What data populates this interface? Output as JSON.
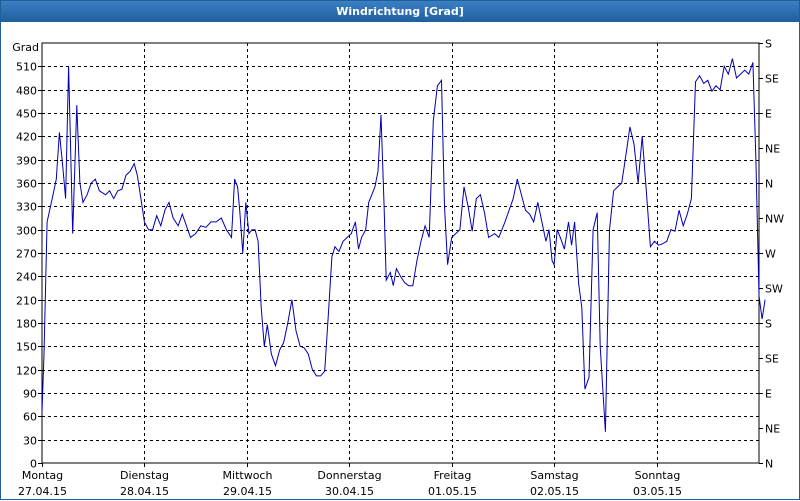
{
  "window": {
    "title": "Windrichtung [Grad]"
  },
  "chart_data": {
    "type": "line",
    "title": "Windrichtung [Grad]",
    "ylabel": "Grad",
    "ylim": [
      0,
      540
    ],
    "yticks": [
      0,
      30,
      60,
      90,
      120,
      150,
      180,
      210,
      240,
      270,
      300,
      330,
      360,
      390,
      420,
      450,
      480,
      510
    ],
    "right_axis_labels": [
      {
        "value": 0,
        "label": "N"
      },
      {
        "value": 45,
        "label": "NE"
      },
      {
        "value": 90,
        "label": "E"
      },
      {
        "value": 135,
        "label": "SE"
      },
      {
        "value": 180,
        "label": "S"
      },
      {
        "value": 225,
        "label": "SW"
      },
      {
        "value": 270,
        "label": "W"
      },
      {
        "value": 315,
        "label": "NW"
      },
      {
        "value": 360,
        "label": "N"
      },
      {
        "value": 405,
        "label": "NE"
      },
      {
        "value": 450,
        "label": "E"
      },
      {
        "value": 495,
        "label": "SE"
      },
      {
        "value": 540,
        "label": "S"
      }
    ],
    "xlim": [
      0,
      7
    ],
    "x_unit": "days since 27.04.15 00:00",
    "xticks": [
      {
        "day": "Montag",
        "date": "27.04.15"
      },
      {
        "day": "Dienstag",
        "date": "28.04.15"
      },
      {
        "day": "Mittwoch",
        "date": "29.04.15"
      },
      {
        "day": "Donnerstag",
        "date": "30.04.15"
      },
      {
        "day": "Freitag",
        "date": "01.05.15"
      },
      {
        "day": "Samstag",
        "date": "02.05.15"
      },
      {
        "day": "Sonntag",
        "date": "03.05.15"
      }
    ],
    "grid": true,
    "line_color": "#0000b4",
    "series": [
      {
        "points": [
          [
            0.0,
            65
          ],
          [
            0.02,
            140
          ],
          [
            0.05,
            310
          ],
          [
            0.1,
            340
          ],
          [
            0.14,
            365
          ],
          [
            0.17,
            425
          ],
          [
            0.2,
            385
          ],
          [
            0.23,
            340
          ],
          [
            0.26,
            510
          ],
          [
            0.3,
            295
          ],
          [
            0.34,
            460
          ],
          [
            0.37,
            360
          ],
          [
            0.4,
            335
          ],
          [
            0.44,
            345
          ],
          [
            0.48,
            360
          ],
          [
            0.52,
            365
          ],
          [
            0.56,
            350
          ],
          [
            0.62,
            345
          ],
          [
            0.66,
            350
          ],
          [
            0.7,
            340
          ],
          [
            0.74,
            350
          ],
          [
            0.78,
            352
          ],
          [
            0.82,
            370
          ],
          [
            0.86,
            375
          ],
          [
            0.9,
            385
          ],
          [
            0.93,
            370
          ],
          [
            0.96,
            345
          ],
          [
            1.0,
            310
          ],
          [
            1.04,
            300
          ],
          [
            1.08,
            300
          ],
          [
            1.12,
            318
          ],
          [
            1.16,
            305
          ],
          [
            1.2,
            325
          ],
          [
            1.24,
            335
          ],
          [
            1.28,
            315
          ],
          [
            1.33,
            305
          ],
          [
            1.37,
            320
          ],
          [
            1.41,
            305
          ],
          [
            1.45,
            290
          ],
          [
            1.5,
            295
          ],
          [
            1.55,
            305
          ],
          [
            1.6,
            303
          ],
          [
            1.65,
            310
          ],
          [
            1.7,
            310
          ],
          [
            1.75,
            315
          ],
          [
            1.8,
            300
          ],
          [
            1.85,
            290
          ],
          [
            1.88,
            365
          ],
          [
            1.91,
            355
          ],
          [
            1.93,
            325
          ],
          [
            1.96,
            270
          ],
          [
            1.99,
            335
          ],
          [
            2.02,
            295
          ],
          [
            2.05,
            300
          ],
          [
            2.08,
            300
          ],
          [
            2.11,
            285
          ],
          [
            2.14,
            200
          ],
          [
            2.17,
            150
          ],
          [
            2.2,
            178
          ],
          [
            2.24,
            140
          ],
          [
            2.28,
            125
          ],
          [
            2.32,
            145
          ],
          [
            2.36,
            155
          ],
          [
            2.4,
            180
          ],
          [
            2.44,
            210
          ],
          [
            2.48,
            170
          ],
          [
            2.52,
            150
          ],
          [
            2.56,
            148
          ],
          [
            2.6,
            140
          ],
          [
            2.64,
            120
          ],
          [
            2.68,
            112
          ],
          [
            2.72,
            112
          ],
          [
            2.76,
            118
          ],
          [
            2.8,
            200
          ],
          [
            2.83,
            265
          ],
          [
            2.86,
            278
          ],
          [
            2.9,
            272
          ],
          [
            2.94,
            285
          ],
          [
            2.98,
            290
          ],
          [
            3.02,
            295
          ],
          [
            3.06,
            310
          ],
          [
            3.09,
            275
          ],
          [
            3.12,
            290
          ],
          [
            3.16,
            300
          ],
          [
            3.19,
            335
          ],
          [
            3.22,
            345
          ],
          [
            3.25,
            355
          ],
          [
            3.28,
            375
          ],
          [
            3.31,
            448
          ],
          [
            3.34,
            330
          ],
          [
            3.36,
            235
          ],
          [
            3.4,
            245
          ],
          [
            3.43,
            228
          ],
          [
            3.46,
            250
          ],
          [
            3.5,
            240
          ],
          [
            3.54,
            232
          ],
          [
            3.58,
            228
          ],
          [
            3.62,
            228
          ],
          [
            3.66,
            260
          ],
          [
            3.7,
            285
          ],
          [
            3.74,
            305
          ],
          [
            3.78,
            290
          ],
          [
            3.82,
            440
          ],
          [
            3.86,
            485
          ],
          [
            3.9,
            492
          ],
          [
            3.93,
            330
          ],
          [
            3.96,
            255
          ],
          [
            4.0,
            290
          ],
          [
            4.04,
            295
          ],
          [
            4.08,
            300
          ],
          [
            4.12,
            355
          ],
          [
            4.16,
            330
          ],
          [
            4.2,
            298
          ],
          [
            4.24,
            340
          ],
          [
            4.28,
            345
          ],
          [
            4.32,
            322
          ],
          [
            4.36,
            290
          ],
          [
            4.42,
            295
          ],
          [
            4.46,
            290
          ],
          [
            4.52,
            310
          ],
          [
            4.56,
            325
          ],
          [
            4.6,
            340
          ],
          [
            4.64,
            365
          ],
          [
            4.68,
            345
          ],
          [
            4.72,
            325
          ],
          [
            4.76,
            320
          ],
          [
            4.8,
            310
          ],
          [
            4.84,
            335
          ],
          [
            4.88,
            310
          ],
          [
            4.92,
            285
          ],
          [
            4.95,
            300
          ],
          [
            4.98,
            260
          ],
          [
            5.0,
            255
          ],
          [
            5.03,
            300
          ],
          [
            5.06,
            290
          ],
          [
            5.1,
            275
          ],
          [
            5.14,
            310
          ],
          [
            5.17,
            280
          ],
          [
            5.2,
            310
          ],
          [
            5.24,
            230
          ],
          [
            5.27,
            200
          ],
          [
            5.3,
            95
          ],
          [
            5.34,
            110
          ],
          [
            5.38,
            300
          ],
          [
            5.42,
            322
          ],
          [
            5.45,
            150
          ],
          [
            5.5,
            40
          ],
          [
            5.54,
            300
          ],
          [
            5.58,
            350
          ],
          [
            5.62,
            355
          ],
          [
            5.66,
            360
          ],
          [
            5.7,
            395
          ],
          [
            5.74,
            432
          ],
          [
            5.78,
            410
          ],
          [
            5.82,
            360
          ],
          [
            5.86,
            420
          ],
          [
            5.9,
            350
          ],
          [
            5.94,
            278
          ],
          [
            5.98,
            285
          ],
          [
            6.02,
            280
          ],
          [
            6.06,
            282
          ],
          [
            6.1,
            285
          ],
          [
            6.14,
            300
          ],
          [
            6.18,
            298
          ],
          [
            6.22,
            325
          ],
          [
            6.26,
            305
          ],
          [
            6.3,
            320
          ],
          [
            6.34,
            340
          ],
          [
            6.38,
            490
          ],
          [
            6.42,
            498
          ],
          [
            6.46,
            488
          ],
          [
            6.5,
            492
          ],
          [
            6.54,
            478
          ],
          [
            6.58,
            485
          ],
          [
            6.62,
            480
          ],
          [
            6.66,
            510
          ],
          [
            6.7,
            500
          ],
          [
            6.74,
            520
          ],
          [
            6.78,
            495
          ],
          [
            6.82,
            500
          ],
          [
            6.86,
            505
          ],
          [
            6.9,
            500
          ],
          [
            6.94,
            515
          ],
          [
            6.97,
            390
          ],
          [
            7.0,
            215
          ],
          [
            7.03,
            185
          ],
          [
            7.06,
            210
          ]
        ]
      }
    ]
  }
}
